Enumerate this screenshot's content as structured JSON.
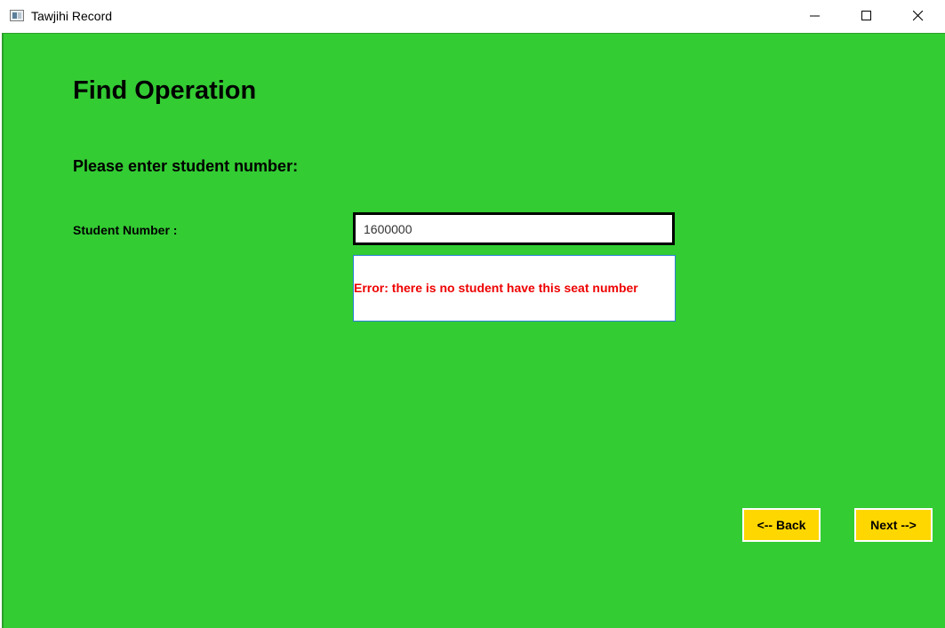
{
  "window": {
    "title": "Tawjihi Record",
    "controls": {
      "minimize": "minimize-icon",
      "maximize": "maximize-icon",
      "close": "close-icon"
    }
  },
  "page": {
    "heading": "Find Operation",
    "prompt": "Please enter student number:"
  },
  "form": {
    "student_number_label": "Student Number :",
    "student_number_value": "1600000"
  },
  "error": {
    "message": "Error: there is no student have this seat number"
  },
  "navigation": {
    "back_label": "<-- Back",
    "next_label": "Next -->"
  },
  "colors": {
    "background": "#33cc33",
    "button": "#ffd700",
    "error_text": "#ee0000",
    "error_border": "#2b7fd6"
  }
}
